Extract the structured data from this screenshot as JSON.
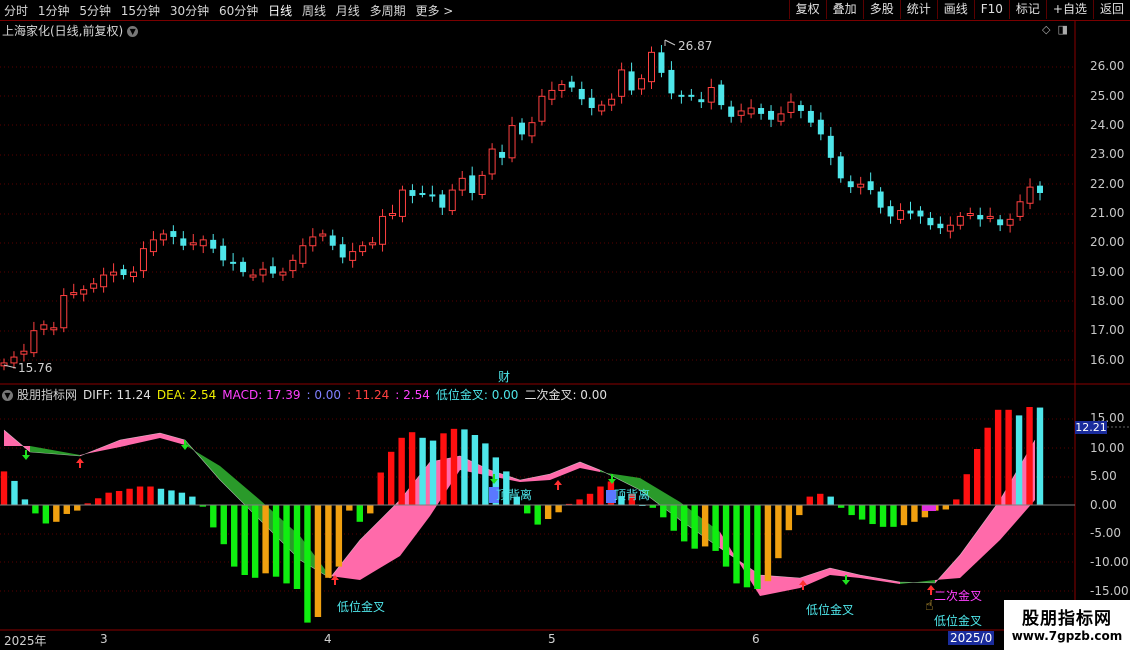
{
  "toolbar": {
    "periods": [
      "分时",
      "1分钟",
      "5分钟",
      "15分钟",
      "30分钟",
      "60分钟",
      "日线",
      "周线",
      "月线",
      "多周期",
      "更多 >"
    ],
    "active": "日线",
    "right_buttons": [
      "复权",
      "叠加",
      "多股",
      "统计",
      "画线",
      "F10",
      "标记",
      "+自选",
      "返回"
    ]
  },
  "stock": {
    "title": "上海家化(日线,前复权)",
    "high_label": "26.87",
    "low_label": "15.76",
    "fin_marker": "财",
    "price_axis": [
      "26.00",
      "25.00",
      "24.00",
      "23.00",
      "22.00",
      "21.00",
      "20.00",
      "19.00",
      "18.00",
      "17.00",
      "16.00"
    ]
  },
  "indicator": {
    "name": "股朋指标网",
    "diff_label": "DIFF: 11.24",
    "dea_label": "DEA: 2.54",
    "macd_label": "MACD: 17.39",
    "v1": ": 0.00",
    "v2": ": 11.24",
    "v3": ": 2.54",
    "low_gold_label": "低位金叉: 0.00",
    "second_gold_label": "二次金叉: 0.00",
    "axis": [
      "15.00",
      "10.00",
      "5.00",
      "0.00",
      "-5.00",
      "-10.00",
      "-15.00"
    ],
    "current_tag": "12.21",
    "annotations": {
      "top_div_1": "顶背离",
      "top_div_2": "顶背离",
      "low_gold_1": "低位金叉",
      "low_gold_2": "低位金叉",
      "low_gold_3": "低位金叉",
      "second_gold": "二次金叉"
    }
  },
  "time_axis": {
    "year": "2025年",
    "months": [
      "3",
      "4",
      "5",
      "6"
    ],
    "current": "2025/0"
  },
  "watermark": {
    "line1": "股朋指标网",
    "line2": "www.7gpzb.com"
  },
  "colors": {
    "up": "#ff4040",
    "down": "#4ee6ea",
    "macd_up": "#ff1010",
    "macd_up_fade": "#4ee6ea",
    "macd_down": "#10ee10",
    "macd_down_fade": "#f0a010",
    "band_pink": "#ff6aaa",
    "band_green": "#2a9a2a"
  }
}
